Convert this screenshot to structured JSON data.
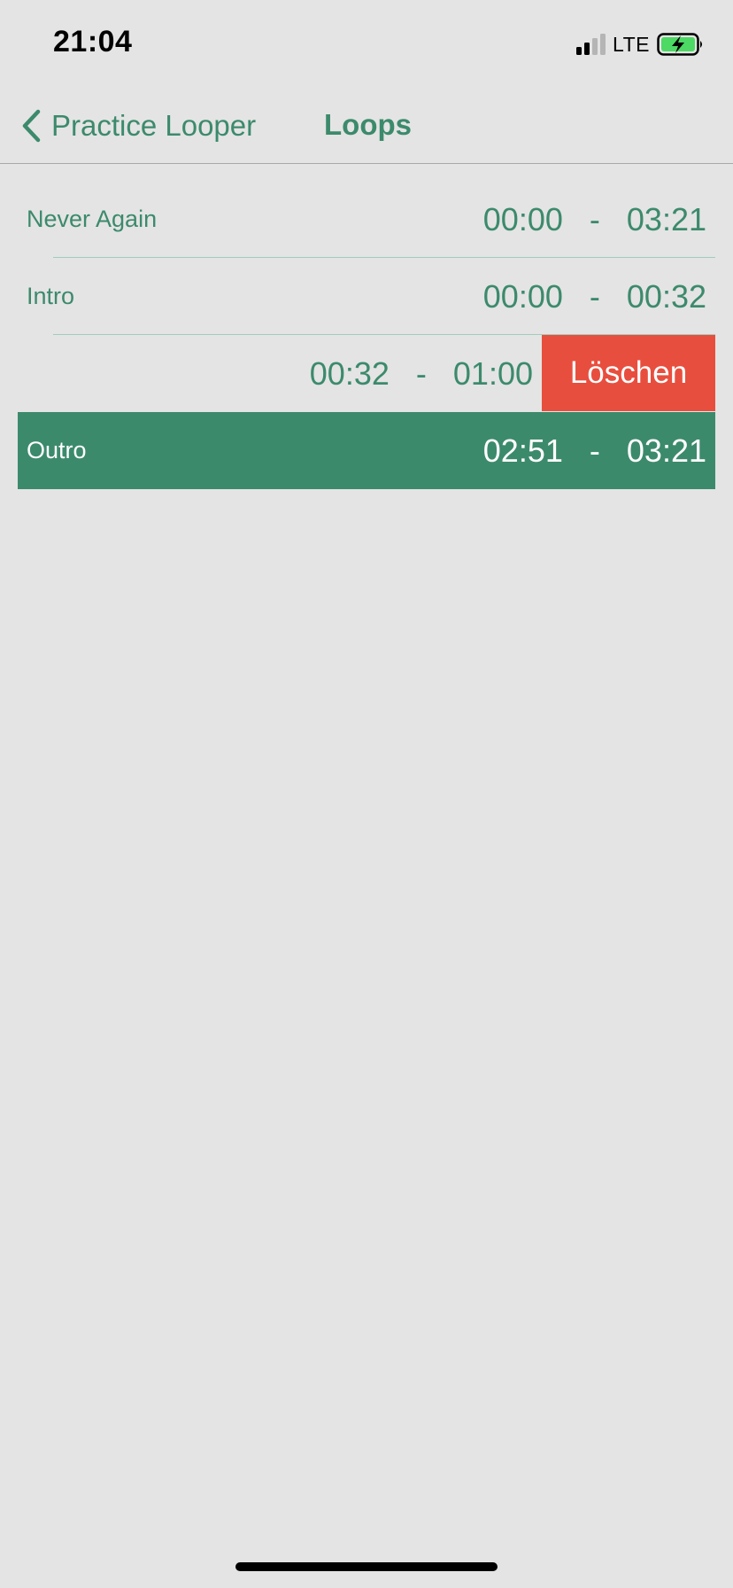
{
  "status_bar": {
    "time": "21:04",
    "network": "LTE",
    "signal_icon": "cellular-signal-icon",
    "battery_icon": "battery-charging-icon",
    "battery_color": "#4cd964"
  },
  "nav": {
    "back_label": "Practice Looper",
    "back_icon": "chevron-left-icon",
    "title": "Loops"
  },
  "loops": [
    {
      "name": "Never Again",
      "start": "00:00",
      "separator": "-",
      "end": "03:21",
      "selected": false,
      "swiped": false
    },
    {
      "name": "Intro",
      "start": "00:00",
      "separator": "-",
      "end": "00:32",
      "selected": false,
      "swiped": false
    },
    {
      "name": "",
      "start": "00:32",
      "separator": "-",
      "end": "01:00",
      "selected": false,
      "swiped": true
    },
    {
      "name": "Outro",
      "start": "02:51",
      "separator": "-",
      "end": "03:21",
      "selected": true,
      "swiped": false
    }
  ],
  "swipe_action": {
    "delete_label": "Löschen",
    "color": "#e84e3e"
  },
  "colors": {
    "accent": "#3c8a6c",
    "background": "#e4e4e4",
    "separator": "#9fcdbb"
  }
}
